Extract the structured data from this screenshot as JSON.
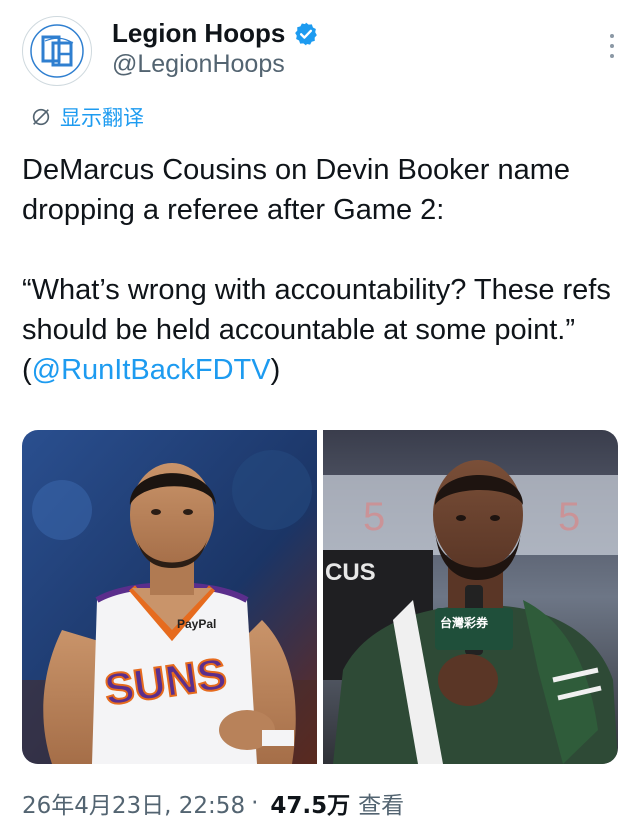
{
  "author": {
    "display_name": "Legion Hoops",
    "handle": "@LegionHoops",
    "avatar_icon": "legion-hoops-logo",
    "verified": true
  },
  "translate": {
    "label": "显示翻译",
    "icon": "translate-globe-icon"
  },
  "tweet": {
    "line1": "DeMarcus Cousins on Devin Booker name dropping a referee after Game 2:",
    "quote": "“What’s wrong with accountability? These refs should be held accountable at some point.” (",
    "mention": "@RunItBackFDTV",
    "closing": ")"
  },
  "media": {
    "left_photo": {
      "jersey_sponsor": "PayPal",
      "jersey_text": "SUNS"
    },
    "right_photo": {
      "mic_flag_text": "台灣彩券",
      "background_letters": "CUS"
    }
  },
  "meta": {
    "timestamp": "26年4月23日, 22:58",
    "separator": "·",
    "views_count": "47.5万",
    "views_label": "查看"
  },
  "colors": {
    "accent": "#1d9bf0",
    "text": "#0f1419",
    "secondary": "#536471"
  }
}
